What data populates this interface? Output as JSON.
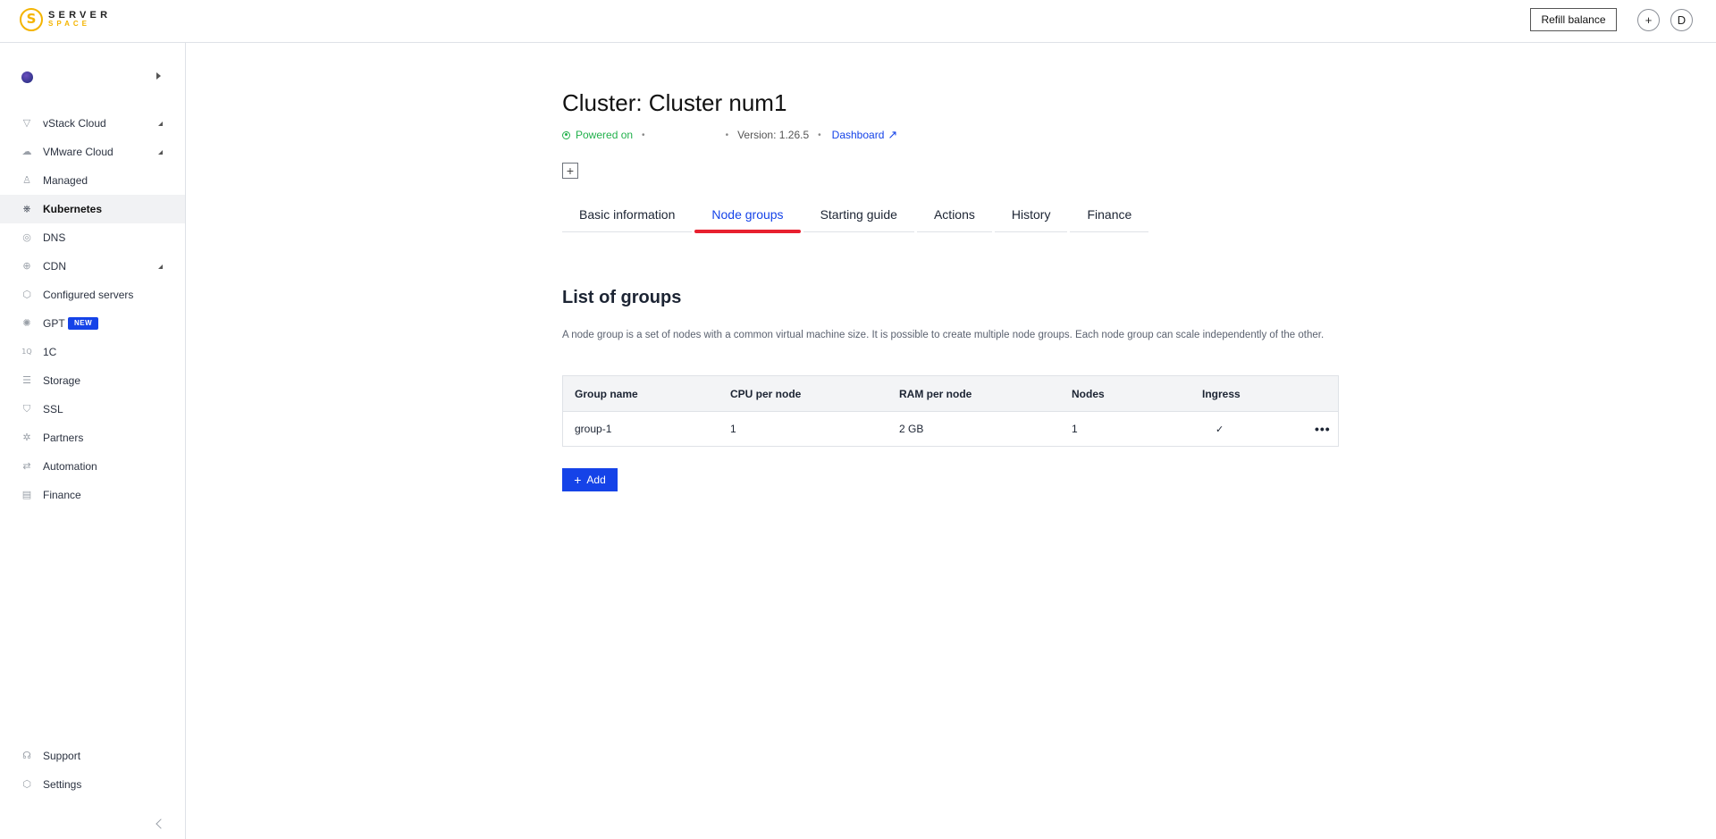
{
  "logo": {
    "line1": "SERVER",
    "line2": "SPACE",
    "mark": "S"
  },
  "header": {
    "refill_label": "Refill balance",
    "add_icon": "+",
    "avatar_initial": "D"
  },
  "sidebar": {
    "items": [
      {
        "label": "vStack Cloud",
        "icon": "▽"
      },
      {
        "label": "VMware Cloud",
        "icon": "☁"
      },
      {
        "label": "Managed",
        "icon": "♙"
      },
      {
        "label": "Kubernetes",
        "icon": "⎈"
      },
      {
        "label": "DNS",
        "icon": "◎"
      },
      {
        "label": "CDN",
        "icon": "⊕"
      },
      {
        "label": "Configured servers",
        "icon": "⬡"
      },
      {
        "label": "GPT",
        "icon": "✺",
        "badge": "NEW"
      },
      {
        "label": "1C",
        "icon": "1Q"
      },
      {
        "label": "Storage",
        "icon": "☰"
      },
      {
        "label": "SSL",
        "icon": "⛉"
      },
      {
        "label": "Partners",
        "icon": "✲"
      },
      {
        "label": "Automation",
        "icon": "⇄"
      },
      {
        "label": "Finance",
        "icon": "▤"
      }
    ],
    "bottom": [
      {
        "label": "Support",
        "icon": "☊"
      },
      {
        "label": "Settings",
        "icon": "⬡"
      }
    ]
  },
  "cluster": {
    "title": "Cluster: Cluster num1",
    "status": "Powered on",
    "version": "Version: 1.26.5",
    "dashboard": "Dashboard",
    "sep": "•",
    "ext_icon": "↗",
    "plus_icon": "+"
  },
  "tabs": [
    "Basic information",
    "Node groups",
    "Starting guide",
    "Actions",
    "History",
    "Finance"
  ],
  "active_tab": "Node groups",
  "groups": {
    "title": "List of groups",
    "description": "A node group is a set of nodes with a common virtual machine size. It is possible to create multiple node groups. Each node group can scale independently of the other.",
    "columns": [
      "Group name",
      "CPU per node",
      "RAM per node",
      "Nodes",
      "Ingress"
    ],
    "rows": [
      {
        "name": "group-1",
        "cpu": "1",
        "ram": "2 GB",
        "nodes": "1",
        "ingress": "✓",
        "more": "•••"
      }
    ],
    "add_label": "Add",
    "add_icon": "+"
  },
  "colors": {
    "accent": "#1543e8",
    "tab_underline": "#e8202f",
    "status_green": "#22b14c",
    "logo": "#f4b400"
  }
}
